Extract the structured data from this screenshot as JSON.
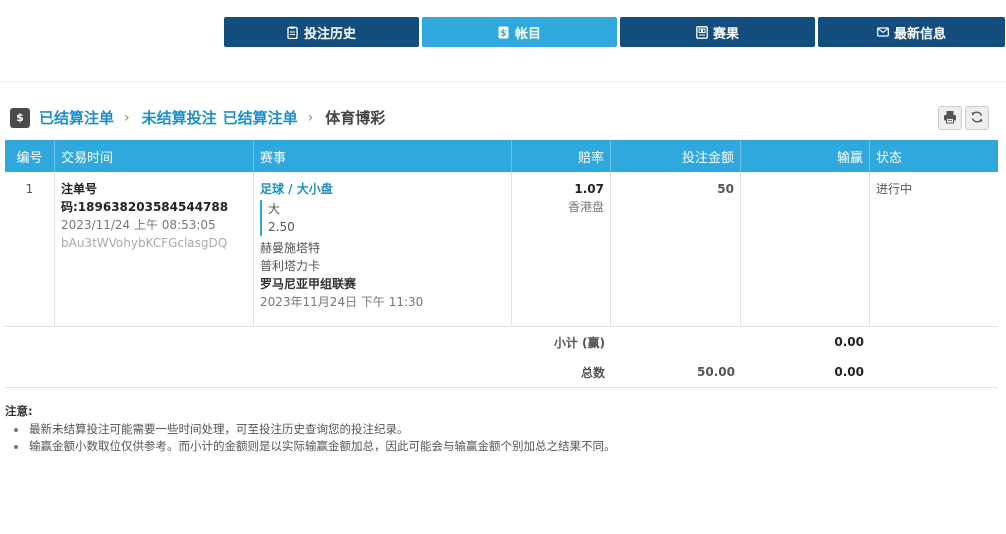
{
  "tabs": [
    {
      "label": "投注历史",
      "icon": "clipboard-icon",
      "active": false
    },
    {
      "label": "帐目",
      "icon": "dollar-document-icon",
      "active": true
    },
    {
      "label": "赛果",
      "icon": "scoreboard-icon",
      "active": false
    },
    {
      "label": "最新信息",
      "icon": "envelope-icon",
      "active": false
    }
  ],
  "breadcrumb": {
    "logo_icon": "dollar-statement-icon",
    "logo_glyph": "$",
    "item1": "已结算注单",
    "item2": "未结算投注",
    "item3": "已结算注单",
    "current": "体育博彩",
    "chevron": "›"
  },
  "tools": {
    "print_icon": "printer-icon",
    "refresh_icon": "refresh-icon"
  },
  "table": {
    "headers": [
      "编号",
      "交易时间",
      "赛事",
      "赔率",
      "投注金额",
      "输赢",
      "状态"
    ],
    "row": {
      "no": "1",
      "bet_id": "注单号码:189638203584544788",
      "datetime": "2023/11/24 上午 08:53:05",
      "ref": "bAu3tWVohybKCFGclasgDQ",
      "market": "足球 / 大小盘",
      "pick": "大",
      "line": "2.50",
      "home": "赫曼施塔特",
      "away": "普利塔力卡",
      "league": "罗马尼亚甲组联赛",
      "match_time": "2023年11月24日 下午 11:30",
      "odds": "1.07",
      "odds_type": "香港盘",
      "stake": "50",
      "winloss": "",
      "status": "进行中"
    },
    "subtotal": {
      "label": "小计 (赢)",
      "stake": "",
      "winloss": "0.00"
    },
    "total": {
      "label": "总数",
      "stake": "50.00",
      "winloss": "0.00"
    }
  },
  "notes": {
    "title": "注意:",
    "items": [
      "最新未结算投注可能需要一些时间处理，可至投注历史查询您的投注纪录。",
      "输赢金额小数取位仅供参考。而小计的金额则是以实际输赢金额加总，因此可能会与输赢金额个别加总之结果不同。"
    ]
  }
}
